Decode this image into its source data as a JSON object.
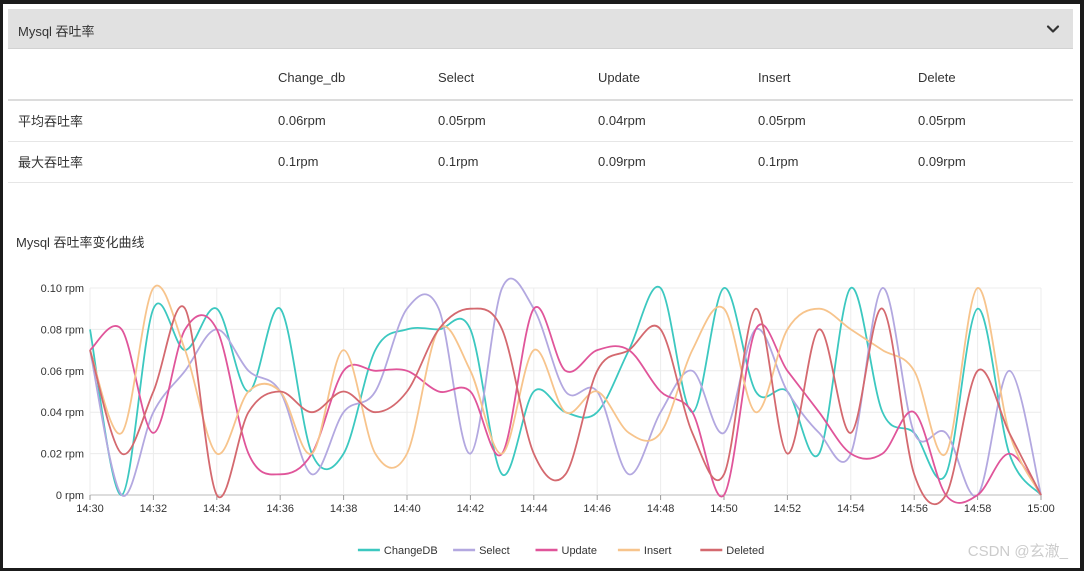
{
  "panel": {
    "title": "Mysql 吞吐率"
  },
  "table": {
    "headers": [
      "",
      "Change_db",
      "Select",
      "Update",
      "Insert",
      "Delete"
    ],
    "rows": [
      [
        "平均吞吐率",
        "0.06rpm",
        "0.05rpm",
        "0.04rpm",
        "0.05rpm",
        "0.05rpm"
      ],
      [
        "最大吞吐率",
        "0.1rpm",
        "0.1rpm",
        "0.09rpm",
        "0.1rpm",
        "0.09rpm"
      ]
    ]
  },
  "chart_section": {
    "title": "Mysql 吞吐率变化曲线"
  },
  "watermark": "CSDN @玄澈_",
  "chart_data": {
    "type": "line",
    "title": "Mysql 吞吐率变化曲线",
    "xlabel": "",
    "ylabel": "",
    "x_ticks": [
      "14:30",
      "14:32",
      "14:34",
      "14:36",
      "14:38",
      "14:40",
      "14:42",
      "14:44",
      "14:46",
      "14:48",
      "14:50",
      "14:52",
      "14:54",
      "14:56",
      "14:58",
      "15:00"
    ],
    "y_ticks": [
      "0 rpm",
      "0.02 rpm",
      "0.04 rpm",
      "0.06 rpm",
      "0.08 rpm",
      "0.10 rpm"
    ],
    "ylim": [
      0,
      0.1
    ],
    "xlim_minutes": [
      0,
      30
    ],
    "grid": true,
    "legend_position": "bottom-center",
    "series": [
      {
        "name": "ChangeDB",
        "color": "#3cc8c0",
        "x": [
          0,
          1,
          2,
          3,
          4,
          5,
          6,
          7,
          8,
          9,
          10,
          11,
          12,
          13,
          14,
          15,
          16,
          17,
          18,
          19,
          20,
          21,
          22,
          23,
          24,
          25,
          26,
          27,
          28,
          29,
          30
        ],
        "values": [
          0.08,
          0.0,
          0.09,
          0.07,
          0.09,
          0.05,
          0.09,
          0.02,
          0.02,
          0.07,
          0.08,
          0.08,
          0.08,
          0.01,
          0.05,
          0.04,
          0.04,
          0.07,
          0.1,
          0.04,
          0.1,
          0.05,
          0.05,
          0.02,
          0.1,
          0.04,
          0.03,
          0.01,
          0.09,
          0.02,
          0.0
        ]
      },
      {
        "name": "Select",
        "color": "#b3a8e0",
        "x": [
          0,
          1,
          2,
          3,
          4,
          5,
          6,
          7,
          8,
          9,
          10,
          11,
          12,
          13,
          14,
          15,
          16,
          17,
          18,
          19,
          20,
          21,
          22,
          23,
          24,
          25,
          26,
          27,
          28,
          29,
          30
        ],
        "values": [
          0.07,
          0.0,
          0.04,
          0.06,
          0.08,
          0.06,
          0.05,
          0.01,
          0.04,
          0.05,
          0.09,
          0.09,
          0.02,
          0.1,
          0.09,
          0.05,
          0.05,
          0.01,
          0.04,
          0.06,
          0.03,
          0.08,
          0.05,
          0.03,
          0.02,
          0.1,
          0.03,
          0.03,
          0.0,
          0.06,
          0.0
        ]
      },
      {
        "name": "Update",
        "color": "#e0559a",
        "x": [
          0,
          1,
          2,
          3,
          4,
          5,
          6,
          7,
          8,
          9,
          10,
          11,
          12,
          13,
          14,
          15,
          16,
          17,
          18,
          19,
          20,
          21,
          22,
          23,
          24,
          25,
          26,
          27,
          28,
          29,
          30
        ],
        "values": [
          0.07,
          0.08,
          0.03,
          0.08,
          0.08,
          0.02,
          0.01,
          0.02,
          0.06,
          0.06,
          0.06,
          0.05,
          0.05,
          0.02,
          0.09,
          0.06,
          0.07,
          0.07,
          0.05,
          0.04,
          0.0,
          0.08,
          0.06,
          0.04,
          0.02,
          0.02,
          0.04,
          0.0,
          0.0,
          0.02,
          0.0
        ]
      },
      {
        "name": "Insert",
        "color": "#f7c48c",
        "x": [
          0,
          1,
          2,
          3,
          4,
          5,
          6,
          7,
          8,
          9,
          10,
          11,
          12,
          13,
          14,
          15,
          16,
          17,
          18,
          19,
          20,
          21,
          22,
          23,
          24,
          25,
          26,
          27,
          28,
          29,
          30
        ],
        "values": [
          0.07,
          0.03,
          0.1,
          0.07,
          0.02,
          0.05,
          0.05,
          0.02,
          0.07,
          0.02,
          0.02,
          0.08,
          0.06,
          0.02,
          0.07,
          0.04,
          0.05,
          0.03,
          0.03,
          0.07,
          0.09,
          0.04,
          0.08,
          0.09,
          0.08,
          0.07,
          0.06,
          0.02,
          0.1,
          0.03,
          0.0
        ]
      },
      {
        "name": "Deleted",
        "color": "#d4696f",
        "x": [
          0,
          1,
          2,
          3,
          4,
          5,
          6,
          7,
          8,
          9,
          10,
          11,
          12,
          13,
          14,
          15,
          16,
          17,
          18,
          19,
          20,
          21,
          22,
          23,
          24,
          25,
          26,
          27,
          28,
          29,
          30
        ],
        "values": [
          0.07,
          0.02,
          0.05,
          0.09,
          0.0,
          0.04,
          0.05,
          0.04,
          0.05,
          0.04,
          0.05,
          0.08,
          0.09,
          0.08,
          0.02,
          0.01,
          0.06,
          0.07,
          0.08,
          0.03,
          0.01,
          0.09,
          0.02,
          0.08,
          0.03,
          0.09,
          0.01,
          0.0,
          0.06,
          0.03,
          0.0
        ]
      }
    ]
  }
}
